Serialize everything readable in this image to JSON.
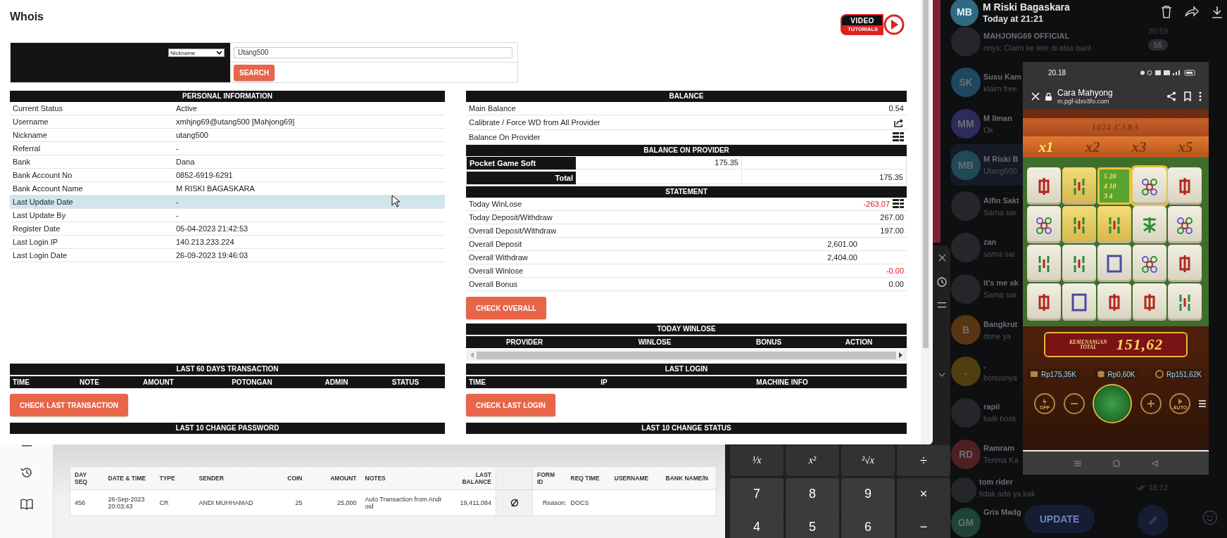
{
  "whois": {
    "title": "Whois",
    "logo": {
      "line_1": "VIDEO",
      "line_2": "TUTORIALS"
    },
    "search": {
      "search_by": "Nickname",
      "value": "Utang500",
      "button": "SEARCH"
    },
    "personal_information": {
      "title": "PERSONAL INFORMATION",
      "rows": [
        {
          "label": "Current Status",
          "value": "Active",
          "hovered": false
        },
        {
          "label": "Username",
          "value": "xmhjng69@utang500  [Mahjong69]",
          "hovered": false
        },
        {
          "label": "Nickname",
          "value": "utang500",
          "hovered": false
        },
        {
          "label": "Referral",
          "value": "-",
          "hovered": false
        },
        {
          "label": "Bank",
          "value": "Dana",
          "hovered": false
        },
        {
          "label": "Bank Account No",
          "value": "0852-6919-6291",
          "hovered": false
        },
        {
          "label": "Bank Account Name",
          "value": "M RISKI BAGASKARA",
          "hovered": false
        },
        {
          "label": "Last Update Date",
          "value": "-",
          "hovered": true
        },
        {
          "label": "Last Update By",
          "value": "-",
          "hovered": false
        },
        {
          "label": "Register Date",
          "value": "05-04-2023 21:42:53",
          "hovered": false
        },
        {
          "label": "Last Login IP",
          "value": "140.213.233.224",
          "hovered": false
        },
        {
          "label": "Last Login Date",
          "value": "26-09-2023 19:46:03",
          "hovered": false
        }
      ]
    },
    "balance": {
      "title": "BALANCE",
      "rows": [
        {
          "kind": "value",
          "label": "Main Balance",
          "value": "0.54"
        },
        {
          "kind": "share",
          "label": "Calibrate / Force WD from All Provider"
        },
        {
          "kind": "list",
          "label": "Balance On Provider"
        }
      ]
    },
    "balance_on_provider": {
      "title": "BALANCE ON PROVIDER",
      "rows": [
        {
          "kind": "provider",
          "name": "Pocket Game Soft",
          "balance": "175.35"
        },
        {
          "kind": "total",
          "name": "Total",
          "total": "175.35"
        }
      ]
    },
    "statement": {
      "title": "STATEMENT",
      "rows": [
        {
          "kind": "main",
          "label": "Today WinLose",
          "value": "-263.07",
          "negative": true,
          "detail_icon": true
        },
        {
          "kind": "main",
          "label": "Today Deposit/Withdraw",
          "value": "267.00",
          "negative": false,
          "detail_icon": false
        },
        {
          "kind": "main",
          "label": "Overall Deposit/Withdraw",
          "value": "197.00",
          "negative": false,
          "detail_icon": false
        },
        {
          "kind": "sub",
          "label": "Overall Deposit",
          "value": "2,601.00",
          "negative": false,
          "detail_icon": false
        },
        {
          "kind": "sub",
          "label": "Overall Withdraw",
          "value": "2,404.00",
          "negative": false,
          "detail_icon": false
        },
        {
          "kind": "main",
          "label": "Overall Winlose",
          "value": "-0.00",
          "negative": true,
          "detail_icon": false
        },
        {
          "kind": "main",
          "label": "Overall Bonus",
          "value": "0.00",
          "negative": false,
          "detail_icon": false
        }
      ]
    },
    "check_overall_button": "CHECK OVERALL",
    "today_winlose": {
      "title": "TODAY WINLOSE",
      "columns": [
        "PROVIDER",
        "WINLOSE",
        "BONUS",
        "ACTION"
      ]
    },
    "last_60_days_transaction": {
      "title": "LAST 60 DAYS TRANSACTION",
      "columns": [
        "TIME",
        "NOTE",
        "AMOUNT",
        "POTONGAN",
        "ADMIN",
        "STATUS"
      ],
      "button": "CHECK LAST TRANSACTION"
    },
    "last_login": {
      "title": "LAST LOGIN",
      "columns": [
        "TIME",
        "IP",
        "MACHINE INFO"
      ],
      "button": "CHECK LAST LOGIN"
    },
    "last_10_change_password": {
      "title": "LAST 10 CHANGE PASSWORD"
    },
    "last_10_change_status": {
      "title": "LAST 10 CHANGE STATUS"
    }
  },
  "transactions_app": {
    "columns": [
      {
        "kind": "text",
        "label": "DAY SEQ"
      },
      {
        "kind": "text",
        "label": "DATE & TIME"
      },
      {
        "kind": "text",
        "label": "TYPE"
      },
      {
        "kind": "text",
        "label": "SENDER"
      },
      {
        "kind": "text",
        "label": "COIN"
      },
      {
        "kind": "text",
        "label": "AMOUNT"
      },
      {
        "kind": "text",
        "label": "NOTES"
      },
      {
        "kind": "text",
        "label": "LAST BALANCE"
      },
      {
        "kind": "icon"
      },
      {
        "kind": "text",
        "label": "FORM ID"
      },
      {
        "kind": "text",
        "label": "REQ TIME"
      },
      {
        "kind": "text",
        "label": "USERNAME"
      },
      {
        "kind": "text",
        "label": "BANK NAME/N"
      }
    ],
    "rows": [
      [
        {
          "kind": "text",
          "value": "456"
        },
        {
          "kind": "text",
          "value": "26-Sep-2023 20:03:43"
        },
        {
          "kind": "text",
          "value": "CR"
        },
        {
          "kind": "text",
          "value": "ANDI MUHHAMAD"
        },
        {
          "kind": "text",
          "value": "25"
        },
        {
          "kind": "text",
          "value": "25,000"
        },
        {
          "kind": "text",
          "value": "Auto Transaction from Android"
        },
        {
          "kind": "text",
          "value": "19,411,084"
        },
        {
          "kind": "icon"
        },
        {
          "kind": "text",
          "value": "Reason:"
        },
        {
          "kind": "text",
          "value": "DOCS"
        }
      ]
    ]
  },
  "calculator": {
    "keys": [
      "¹⁄x",
      "x²",
      "²√x",
      "÷",
      "7",
      "8",
      "9",
      "×",
      "4",
      "5",
      "6",
      "−"
    ]
  },
  "chat": {
    "viewer": {
      "avatar": "MB",
      "name": "M Riski Bagaskara",
      "time": "Today at 21:21"
    },
    "chats": [
      {
        "avatar": {
          "kind": "photo"
        },
        "name": "MAHJONG69 OFFICIAL",
        "preview": "noys: Claim ke tele di atas bant",
        "time": "20:59",
        "unread": "55",
        "read": false,
        "selected": false
      },
      {
        "avatar": {
          "kind": "initials",
          "text": "SK",
          "color": "#1e4760"
        },
        "name": "Susu Kam",
        "preview": "klaim free",
        "selected": false
      },
      {
        "avatar": {
          "kind": "initials",
          "text": "MM",
          "color": "#2f2a5c"
        },
        "name": "M Ilman",
        "preview": "Ok",
        "selected": false
      },
      {
        "avatar": {
          "kind": "initials",
          "text": "MB",
          "color": "#1f4a57"
        },
        "name": "M Riski B",
        "preview": "Utang500",
        "selected": true
      },
      {
        "avatar": {
          "kind": "photo"
        },
        "name": "Alfin Sakt",
        "preview": "Sama sar",
        "selected": false
      },
      {
        "avatar": {
          "kind": "photo"
        },
        "name": "zan",
        "preview": "sama sar",
        "selected": false
      },
      {
        "avatar": {
          "kind": "photo"
        },
        "name": "it's me sk",
        "preview": "Sama sar",
        "selected": false
      },
      {
        "avatar": {
          "kind": "initials",
          "text": "B",
          "color": "#5a3512"
        },
        "name": "Bangkrut",
        "preview": "done ya",
        "selected": false
      },
      {
        "avatar": {
          "kind": "initials",
          "text": ".",
          "color": "#4f3f10"
        },
        "name": ".",
        "preview": "bonusnya",
        "selected": false
      },
      {
        "avatar": {
          "kind": "photo"
        },
        "name": "rapii",
        "preview": "baik bosk",
        "selected": false
      },
      {
        "avatar": {
          "kind": "initials",
          "text": "RD",
          "color": "#4f1f22"
        },
        "name": "Ramram",
        "preview": "Terima Ka",
        "selected": false
      },
      {
        "avatar": {
          "kind": "photo"
        },
        "name": "tom rider",
        "preview": "tidak ada ya kak",
        "time": "18:12",
        "read": true,
        "selected": false
      },
      {
        "avatar": {
          "kind": "initials",
          "text": "GM",
          "color": "#1d4434"
        },
        "name": "Gris Madg",
        "selected": false
      }
    ],
    "update_button": "UPDATE"
  },
  "phone": {
    "status_time": "20.18",
    "page_title": "Cara Mahyong",
    "url": "m.pgf-idxv3fo.com",
    "game": {
      "ways": "1024 CARA",
      "multipliers": [
        {
          "label": "x1",
          "selected": true
        },
        {
          "label": "x2",
          "selected": false
        },
        {
          "label": "x3",
          "selected": false
        },
        {
          "label": "x5",
          "selected": false
        }
      ],
      "paytable": [
        "5 20",
        "4 10",
        "3 4"
      ],
      "win_label": "KEMENANGAN TOTAL",
      "win_amount": "151,62",
      "balances": [
        "Rp175,35K",
        "Rp0,60K",
        "Rp151,62K"
      ],
      "turbo_label": "OFF",
      "auto_label": "AUTO"
    }
  }
}
